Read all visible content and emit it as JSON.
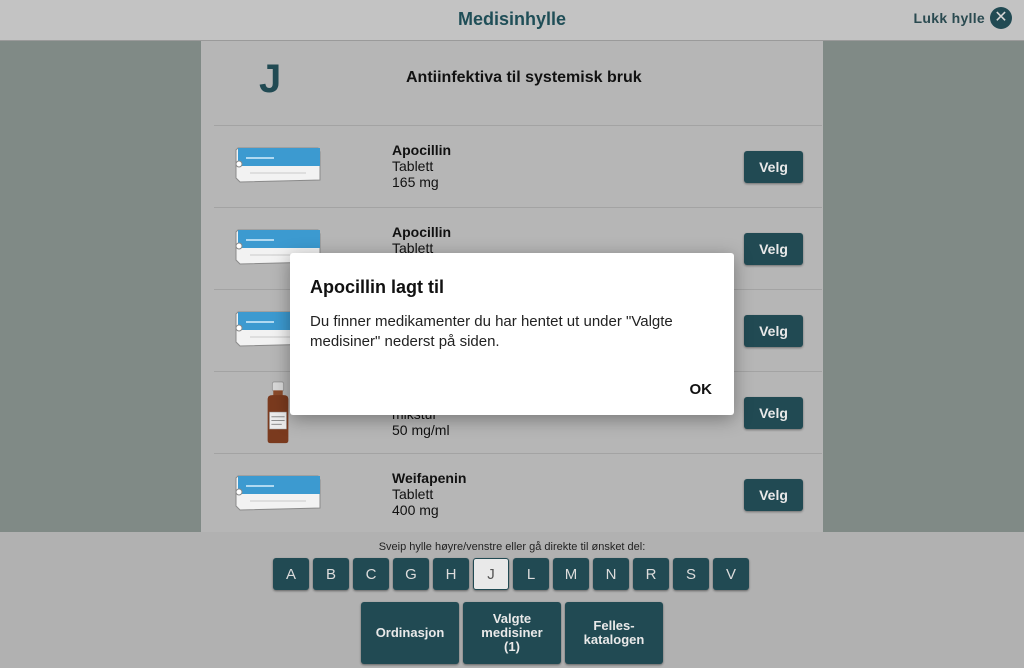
{
  "header": {
    "title": "Medisinhylle",
    "close_label": "Lukk hylle",
    "close_icon": "close-icon"
  },
  "shelf": {
    "letter": "J",
    "group_title": "Antiinfektiva til systemisk bruk",
    "items": [
      {
        "name": "Apocillin",
        "form": "Tablett",
        "dose": "165 mg",
        "image": "pill-box",
        "button": "Velg"
      },
      {
        "name": "Apocillin",
        "form": "Tablett",
        "dose": "",
        "image": "pill-box",
        "button": "Velg"
      },
      {
        "name": "",
        "form": "",
        "dose": "",
        "image": "pill-box",
        "button": "Velg"
      },
      {
        "name": "",
        "form": "mikstur",
        "dose": "50 mg/ml",
        "image": "medicine-bottle",
        "button": "Velg"
      },
      {
        "name": "Weifapenin",
        "form": "Tablett",
        "dose": "400 mg",
        "image": "pill-box",
        "button": "Velg"
      }
    ]
  },
  "bottom": {
    "hint": "Sveip hylle høyre/venstre eller gå direkte til ønsket del:",
    "letters": [
      "A",
      "B",
      "C",
      "G",
      "H",
      "J",
      "L",
      "M",
      "N",
      "R",
      "S",
      "V"
    ],
    "active_letter": "J",
    "actions": [
      {
        "label": "Ordinasjon"
      },
      {
        "label": "Valgte\nmedisiner\n(1)"
      },
      {
        "label": "Felles-\nkatalogen"
      }
    ]
  },
  "dialog": {
    "title": "Apocillin lagt til",
    "body": "Du finner medikamenter du har hentet ut under \"Valgte medisiner\" nederst på siden.",
    "ok_label": "OK"
  },
  "colors": {
    "accent": "#214a53",
    "shelf_bg": "#b6b6b6",
    "side_bg": "#808a86"
  }
}
